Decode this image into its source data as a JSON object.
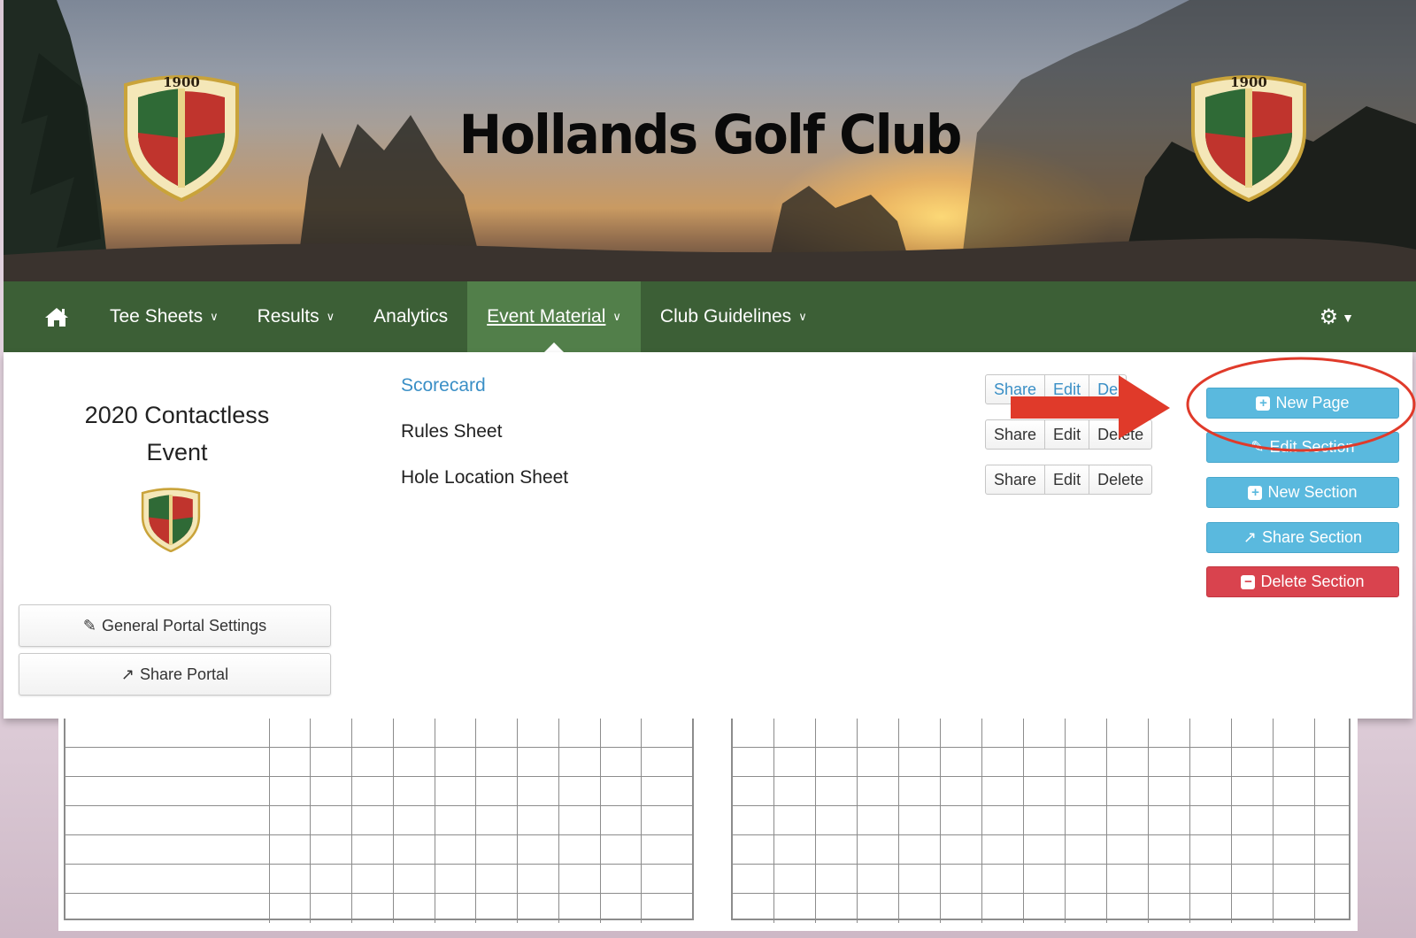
{
  "site": {
    "title": "Hollands Golf Club",
    "crest_year": "1900"
  },
  "nav": {
    "items": [
      {
        "label": "Tee Sheets",
        "has_dropdown": true
      },
      {
        "label": "Results",
        "has_dropdown": true
      },
      {
        "label": "Analytics",
        "has_dropdown": false
      },
      {
        "label": "Event Material",
        "has_dropdown": true,
        "active": true
      },
      {
        "label": "Club Guidelines",
        "has_dropdown": true
      }
    ],
    "home_icon": "home-icon",
    "settings_icon": "gears-icon"
  },
  "portal": {
    "title": "2020 Contactless Event",
    "general_settings_label": "General Portal Settings",
    "share_portal_label": "Share Portal"
  },
  "pages": [
    {
      "name": "Scorecard",
      "active": true
    },
    {
      "name": "Rules Sheet",
      "active": false
    },
    {
      "name": "Hole Location Sheet",
      "active": false
    }
  ],
  "row_actions": {
    "share": "Share",
    "edit": "Edit",
    "delete": "Delete",
    "delete_partial": "De"
  },
  "section_actions": {
    "new_page": "New Page",
    "edit_section": "Edit Section",
    "new_section": "New Section",
    "share_section": "Share Section",
    "delete_section": "Delete Section"
  },
  "colors": {
    "nav_bg": "#3c5f36",
    "nav_active": "#527f4a",
    "info_button": "#5ab9de",
    "danger_button": "#d9434e",
    "link": "#3a8fc6",
    "annotation": "#e03a2a"
  }
}
